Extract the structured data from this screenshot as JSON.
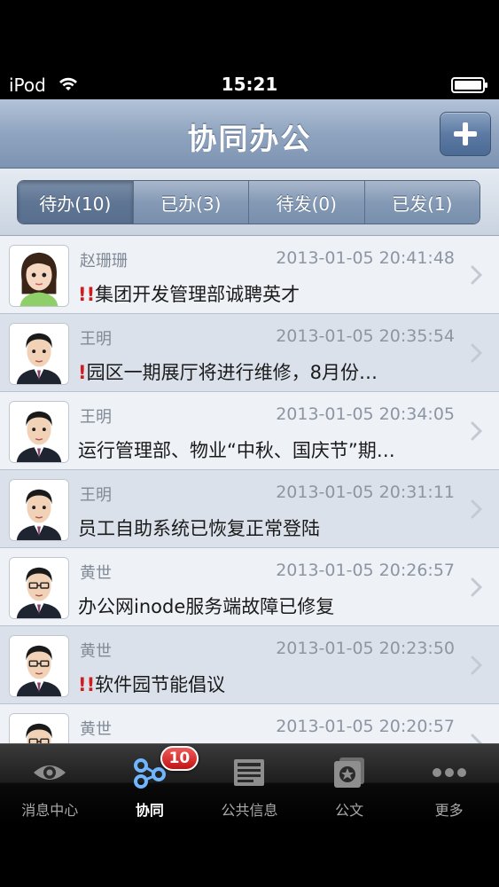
{
  "status_bar": {
    "carrier": "iPod",
    "time": "15:21"
  },
  "nav": {
    "title": "协同办公",
    "add_button_icon": "plus-icon"
  },
  "segments": [
    {
      "label": "待办(10)",
      "selected": true
    },
    {
      "label": "已办(3)",
      "selected": false
    },
    {
      "label": "待发(0)",
      "selected": false
    },
    {
      "label": "已发(1)",
      "selected": false
    }
  ],
  "messages": [
    {
      "sender": "赵珊珊",
      "time": "2013-01-05 20:41:48",
      "urgency": "!!",
      "subject": "集团开发管理部诚聘英才",
      "avatar": "female-avatar"
    },
    {
      "sender": "王明",
      "time": "2013-01-05 20:35:54",
      "urgency": "!",
      "subject": "园区一期展厅将进行维修，8月份…",
      "avatar": "male-avatar"
    },
    {
      "sender": "王明",
      "time": "2013-01-05 20:34:05",
      "urgency": "",
      "subject": "运行管理部、物业“中秋、国庆节”期…",
      "avatar": "male-avatar"
    },
    {
      "sender": "王明",
      "time": "2013-01-05 20:31:11",
      "urgency": "",
      "subject": "员工自助系统已恢复正常登陆",
      "avatar": "male-avatar"
    },
    {
      "sender": "黄世",
      "time": "2013-01-05 20:26:57",
      "urgency": "",
      "subject": "办公网inode服务端故障已修复",
      "avatar": "male-glasses-avatar"
    },
    {
      "sender": "黄世",
      "time": "2013-01-05 20:23:50",
      "urgency": "!!",
      "subject": "软件园节能倡议",
      "avatar": "male-glasses-avatar"
    },
    {
      "sender": "黄世",
      "time": "2013-01-05 20:20:57",
      "urgency": "",
      "subject": "",
      "avatar": "male-glasses-avatar"
    }
  ],
  "tabs": [
    {
      "label": "消息中心",
      "icon": "eye-icon",
      "active": false,
      "badge": ""
    },
    {
      "label": "协同",
      "icon": "collaboration-icon",
      "active": true,
      "badge": "10"
    },
    {
      "label": "公共信息",
      "icon": "bulletin-icon",
      "active": false,
      "badge": ""
    },
    {
      "label": "公文",
      "icon": "document-icon",
      "active": false,
      "badge": ""
    },
    {
      "label": "更多",
      "icon": "more-icon",
      "active": false,
      "badge": ""
    }
  ],
  "colors": {
    "urgent": "#d01c1c",
    "nav_blue": "#8fa4bf",
    "badge_red": "#c21414"
  }
}
